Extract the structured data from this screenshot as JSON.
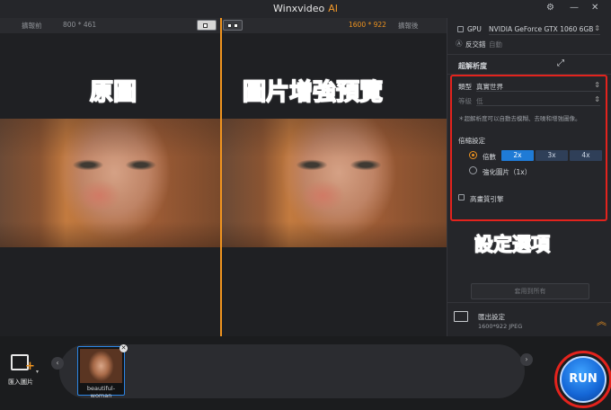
{
  "app": {
    "title": "Winxvideo",
    "title_ai": "AI"
  },
  "window": {
    "settings_icon": "gear-icon",
    "minimize": "—",
    "close": "✕"
  },
  "preview": {
    "before_label": "擴報前",
    "before_size": "800 * 461",
    "after_size": "1600 * 922",
    "after_label": "擴報後",
    "overlay_original": "原圖",
    "overlay_enhanced": "圖片增強預覽"
  },
  "settings": {
    "gpu_label": "GPU",
    "gpu_value": "NVIDIA GeForce GTX 1060 6GB",
    "anti_aliasing_label": "反交錯",
    "anti_aliasing_value": "自動",
    "super_resolution_title": "超解析度",
    "type_label": "類型",
    "type_value": "真實世界",
    "level_label": "等級",
    "level_value": "低",
    "note": "＊超解析度可以自動去模糊、去噪和增強圖像。",
    "scale_title": "倍縮設定",
    "scale_option": "倍數",
    "scale_buttons": [
      "2x",
      "3x",
      "4x"
    ],
    "enhance_option": "強化圖片（1x）",
    "hq_engine_label": "高畫質引擎",
    "annotation": "設定選項",
    "apply_all": "套用到所有",
    "output_title": "匯出設定",
    "output_info": "1600*922  JPEG"
  },
  "bottom": {
    "import_label": "匯入圖片",
    "thumb_caption": "beautiful-woman",
    "run": "RUN"
  },
  "colors": {
    "accent": "#f0941f",
    "annotation_red": "#e3231d",
    "selected_blue": "#1f7bd6"
  }
}
